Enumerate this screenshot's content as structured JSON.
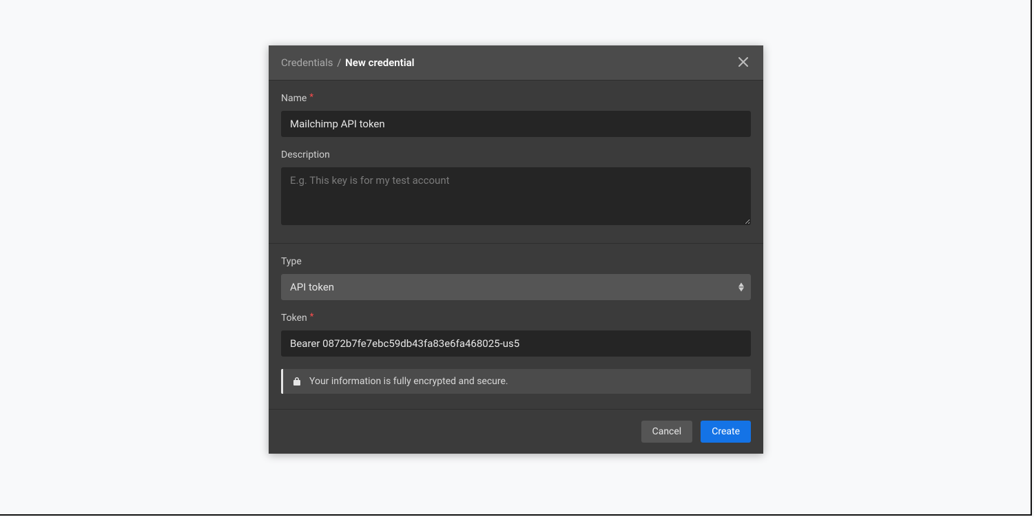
{
  "header": {
    "breadcrumb_parent": "Credentials",
    "breadcrumb_separator": "/",
    "title": "New credential"
  },
  "fields": {
    "name": {
      "label": "Name",
      "required_marker": "*",
      "value": "Mailchimp API token"
    },
    "description": {
      "label": "Description",
      "placeholder": "E.g. This key is for my test account",
      "value": ""
    },
    "type": {
      "label": "Type",
      "selected": "API token"
    },
    "token": {
      "label": "Token",
      "required_marker": "*",
      "value": "Bearer 0872b7fe7ebc59db43fa83e6fa468025-us5"
    }
  },
  "banner": {
    "message": "Your information is fully encrypted and secure."
  },
  "footer": {
    "cancel": "Cancel",
    "create": "Create"
  }
}
